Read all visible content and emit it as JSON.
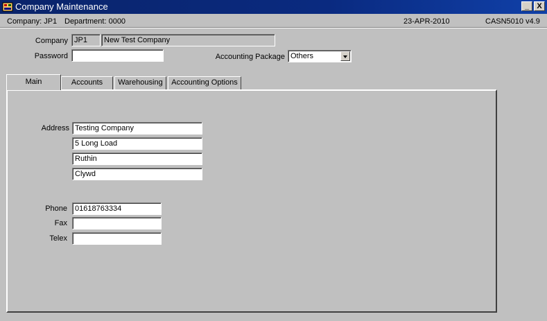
{
  "window": {
    "title": "Company Maintenance",
    "minimize_label": "_",
    "close_label": "X"
  },
  "info": {
    "company": "Company:  JP1",
    "department": "Department:  0000",
    "date": "23-APR-2010",
    "program": "CASN5010  v4.9"
  },
  "header": {
    "company_label": "Company",
    "company_code": "JP1",
    "company_name": "New Test Company",
    "password_label": "Password",
    "password_value": "",
    "accounting_label": "Accounting Package",
    "accounting_value": "Others"
  },
  "tabs": [
    {
      "label": "Main",
      "active": true
    },
    {
      "label": "Accounts",
      "active": false
    },
    {
      "label": "Warehousing",
      "active": false
    },
    {
      "label": "Accounting Options",
      "active": false
    }
  ],
  "main": {
    "address_label": "Address",
    "address": [
      "Testing Company",
      "5 Long Load",
      "Ruthin",
      "Clywd"
    ],
    "phone_label": "Phone",
    "phone_value": "01618763334",
    "fax_label": "Fax",
    "fax_value": "",
    "telex_label": "Telex",
    "telex_value": ""
  }
}
